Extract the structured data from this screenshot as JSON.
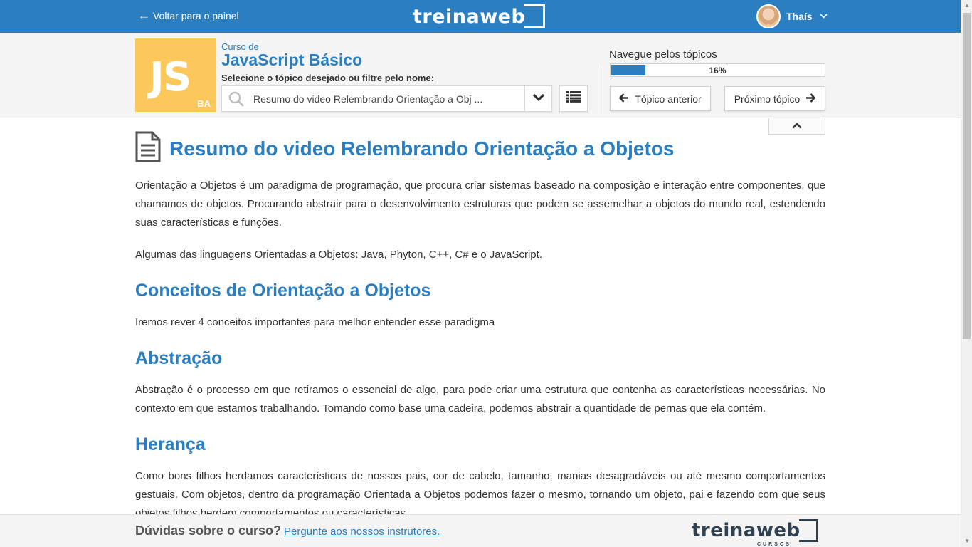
{
  "topbar": {
    "back_label": "Voltar para o painel",
    "logo": "treinaweb",
    "user_name": "Thaís"
  },
  "course": {
    "badge_main": "JS",
    "badge_sub": "BA",
    "course_of": "Curso de",
    "course_name": "JavaScript Básico",
    "select_hint": "Selecione o tópico desejado ou filtre pelo nome:",
    "selected_topic": "Resumo do video Relembrando Orientação a Obj ..."
  },
  "navigation": {
    "title": "Navegue pelos tópicos",
    "progress_label": "16%",
    "progress_value": 16,
    "prev_label": "Tópico anterior",
    "next_label": "Próximo tópico"
  },
  "article": {
    "title": "Resumo do video Relembrando Orientação a Objetos",
    "p1": "Orientação a Objetos é um paradigma de programação, que procura criar sistemas baseado na composição e interação entre componentes, que chamamos de objetos. Procurando abstrair para o desenvolvimento estruturas que podem se assemelhar a objetos do mundo real, estendendo suas características e funções.",
    "p2": "Algumas das linguagens Orientadas a Objetos: Java, Phyton, C++, C# e o JavaScript.",
    "h_concepts": "Conceitos de Orientação a Objetos",
    "p3": "Iremos rever 4 conceitos importantes para melhor entender esse paradigma",
    "h_abstraction": "Abstração",
    "p4": "Abstração é o processo em que retiramos o essencial de algo, para pode criar uma estrutura que contenha as características necessárias. No contexto em que estamos trabalhando. Tomando como base uma cadeira, podemos abstrair a quantidade de pernas que ela contém.",
    "h_inheritance": "Herança",
    "p5": "Como bons filhos herdamos características de nossos pais, cor de cabelo, tamanho, manias desagradáveis ou até mesmo comportamentos gestuais. Com objetos, dentro da programação Orientada a Objetos podemos fazer o mesmo, tornando um objeto, pai e fazendo com que seus objetos filhos herdem comportamentos ou características."
  },
  "footer": {
    "question": "Dúvidas sobre o curso?",
    "ask_link": "Pergunte aos nossos instrutores.",
    "logo": "treinaweb",
    "logo_sub": "CURSOS"
  },
  "colors": {
    "brand_blue": "#2b7fc1",
    "badge_yellow": "#fcc85c"
  }
}
